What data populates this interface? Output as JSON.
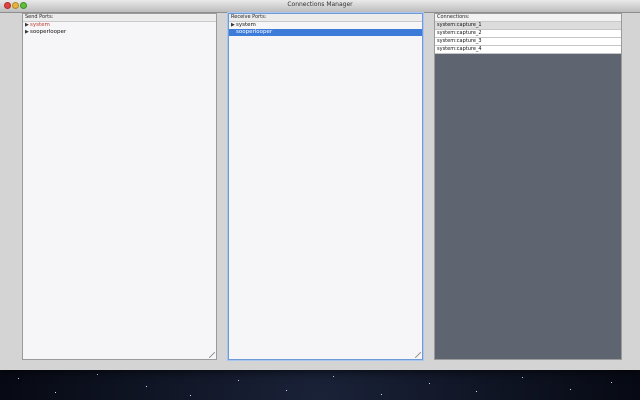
{
  "window": {
    "title": "Connections Manager"
  },
  "send_ports": {
    "header": "Send Ports:",
    "items": [
      {
        "label": "system",
        "state": "red"
      },
      {
        "label": "sooperlooper",
        "state": "normal"
      }
    ]
  },
  "receive_ports": {
    "header": "Receive Ports:",
    "items": [
      {
        "label": "system",
        "state": "normal"
      },
      {
        "label": "sooperlooper",
        "state": "selected"
      }
    ]
  },
  "connections": {
    "header": "Connections:",
    "items": [
      "system:capture_1",
      "system:capture_2",
      "system:capture_3",
      "system:capture_4"
    ]
  },
  "colors": {
    "selection": "#3d7bd9",
    "alert_text": "#c0392b",
    "connections_bg": "#5f6570"
  }
}
